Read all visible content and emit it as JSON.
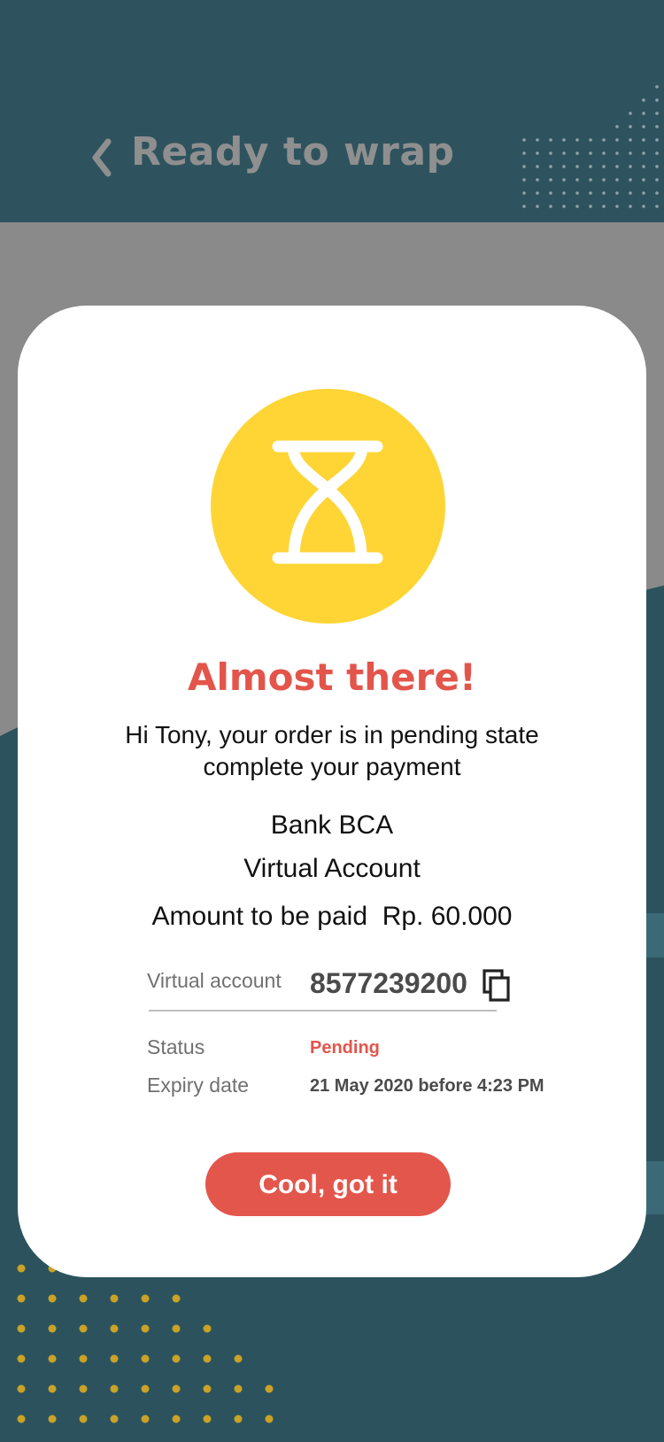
{
  "header": {
    "title": "Ready to wrap"
  },
  "dialog": {
    "heading": "Almost there!",
    "message_line1": "Hi Tony, your order is in pending state",
    "message_line2": "complete your payment",
    "bank": "Bank BCA",
    "method": "Virtual Account",
    "amount_label": "Amount to be paid",
    "amount_value": "Rp. 60.000",
    "virtual_account_label": "Virtual account",
    "virtual_account_number": "8577239200",
    "status_label": "Status",
    "status_value": "Pending",
    "expiry_label": "Expiry date",
    "expiry_value": "21 May 2020 before 4:23 PM",
    "confirm_button": "Cool, got it"
  },
  "colors": {
    "header_bg": "#2e535e",
    "accent_red": "#e3554b",
    "icon_yellow": "#fed535",
    "dots_gold": "#c9a227"
  },
  "icons": {
    "back": "chevron-left-icon",
    "status": "hourglass-icon",
    "copy": "copy-icon"
  }
}
